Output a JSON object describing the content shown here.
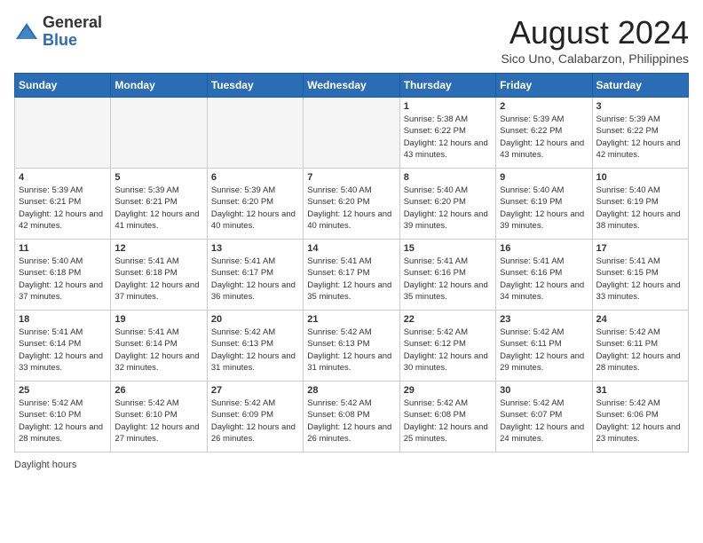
{
  "header": {
    "logo_general": "General",
    "logo_blue": "Blue",
    "title": "August 2024",
    "subtitle": "Sico Uno, Calabarzon, Philippines"
  },
  "days_of_week": [
    "Sunday",
    "Monday",
    "Tuesday",
    "Wednesday",
    "Thursday",
    "Friday",
    "Saturday"
  ],
  "weeks": [
    [
      {
        "day": "",
        "sunrise": "",
        "sunset": "",
        "daylight": "",
        "empty": true
      },
      {
        "day": "",
        "sunrise": "",
        "sunset": "",
        "daylight": "",
        "empty": true
      },
      {
        "day": "",
        "sunrise": "",
        "sunset": "",
        "daylight": "",
        "empty": true
      },
      {
        "day": "",
        "sunrise": "",
        "sunset": "",
        "daylight": "",
        "empty": true
      },
      {
        "day": "1",
        "sunrise": "5:38 AM",
        "sunset": "6:22 PM",
        "daylight": "12 hours and 43 minutes."
      },
      {
        "day": "2",
        "sunrise": "5:39 AM",
        "sunset": "6:22 PM",
        "daylight": "12 hours and 43 minutes."
      },
      {
        "day": "3",
        "sunrise": "5:39 AM",
        "sunset": "6:22 PM",
        "daylight": "12 hours and 42 minutes."
      }
    ],
    [
      {
        "day": "4",
        "sunrise": "5:39 AM",
        "sunset": "6:21 PM",
        "daylight": "12 hours and 42 minutes."
      },
      {
        "day": "5",
        "sunrise": "5:39 AM",
        "sunset": "6:21 PM",
        "daylight": "12 hours and 41 minutes."
      },
      {
        "day": "6",
        "sunrise": "5:39 AM",
        "sunset": "6:20 PM",
        "daylight": "12 hours and 40 minutes."
      },
      {
        "day": "7",
        "sunrise": "5:40 AM",
        "sunset": "6:20 PM",
        "daylight": "12 hours and 40 minutes."
      },
      {
        "day": "8",
        "sunrise": "5:40 AM",
        "sunset": "6:20 PM",
        "daylight": "12 hours and 39 minutes."
      },
      {
        "day": "9",
        "sunrise": "5:40 AM",
        "sunset": "6:19 PM",
        "daylight": "12 hours and 39 minutes."
      },
      {
        "day": "10",
        "sunrise": "5:40 AM",
        "sunset": "6:19 PM",
        "daylight": "12 hours and 38 minutes."
      }
    ],
    [
      {
        "day": "11",
        "sunrise": "5:40 AM",
        "sunset": "6:18 PM",
        "daylight": "12 hours and 37 minutes."
      },
      {
        "day": "12",
        "sunrise": "5:41 AM",
        "sunset": "6:18 PM",
        "daylight": "12 hours and 37 minutes."
      },
      {
        "day": "13",
        "sunrise": "5:41 AM",
        "sunset": "6:17 PM",
        "daylight": "12 hours and 36 minutes."
      },
      {
        "day": "14",
        "sunrise": "5:41 AM",
        "sunset": "6:17 PM",
        "daylight": "12 hours and 35 minutes."
      },
      {
        "day": "15",
        "sunrise": "5:41 AM",
        "sunset": "6:16 PM",
        "daylight": "12 hours and 35 minutes."
      },
      {
        "day": "16",
        "sunrise": "5:41 AM",
        "sunset": "6:16 PM",
        "daylight": "12 hours and 34 minutes."
      },
      {
        "day": "17",
        "sunrise": "5:41 AM",
        "sunset": "6:15 PM",
        "daylight": "12 hours and 33 minutes."
      }
    ],
    [
      {
        "day": "18",
        "sunrise": "5:41 AM",
        "sunset": "6:14 PM",
        "daylight": "12 hours and 33 minutes."
      },
      {
        "day": "19",
        "sunrise": "5:41 AM",
        "sunset": "6:14 PM",
        "daylight": "12 hours and 32 minutes."
      },
      {
        "day": "20",
        "sunrise": "5:42 AM",
        "sunset": "6:13 PM",
        "daylight": "12 hours and 31 minutes."
      },
      {
        "day": "21",
        "sunrise": "5:42 AM",
        "sunset": "6:13 PM",
        "daylight": "12 hours and 31 minutes."
      },
      {
        "day": "22",
        "sunrise": "5:42 AM",
        "sunset": "6:12 PM",
        "daylight": "12 hours and 30 minutes."
      },
      {
        "day": "23",
        "sunrise": "5:42 AM",
        "sunset": "6:11 PM",
        "daylight": "12 hours and 29 minutes."
      },
      {
        "day": "24",
        "sunrise": "5:42 AM",
        "sunset": "6:11 PM",
        "daylight": "12 hours and 28 minutes."
      }
    ],
    [
      {
        "day": "25",
        "sunrise": "5:42 AM",
        "sunset": "6:10 PM",
        "daylight": "12 hours and 28 minutes."
      },
      {
        "day": "26",
        "sunrise": "5:42 AM",
        "sunset": "6:10 PM",
        "daylight": "12 hours and 27 minutes."
      },
      {
        "day": "27",
        "sunrise": "5:42 AM",
        "sunset": "6:09 PM",
        "daylight": "12 hours and 26 minutes."
      },
      {
        "day": "28",
        "sunrise": "5:42 AM",
        "sunset": "6:08 PM",
        "daylight": "12 hours and 26 minutes."
      },
      {
        "day": "29",
        "sunrise": "5:42 AM",
        "sunset": "6:08 PM",
        "daylight": "12 hours and 25 minutes."
      },
      {
        "day": "30",
        "sunrise": "5:42 AM",
        "sunset": "6:07 PM",
        "daylight": "12 hours and 24 minutes."
      },
      {
        "day": "31",
        "sunrise": "5:42 AM",
        "sunset": "6:06 PM",
        "daylight": "12 hours and 23 minutes."
      }
    ]
  ],
  "legend": {
    "daylight_label": "Daylight hours"
  }
}
